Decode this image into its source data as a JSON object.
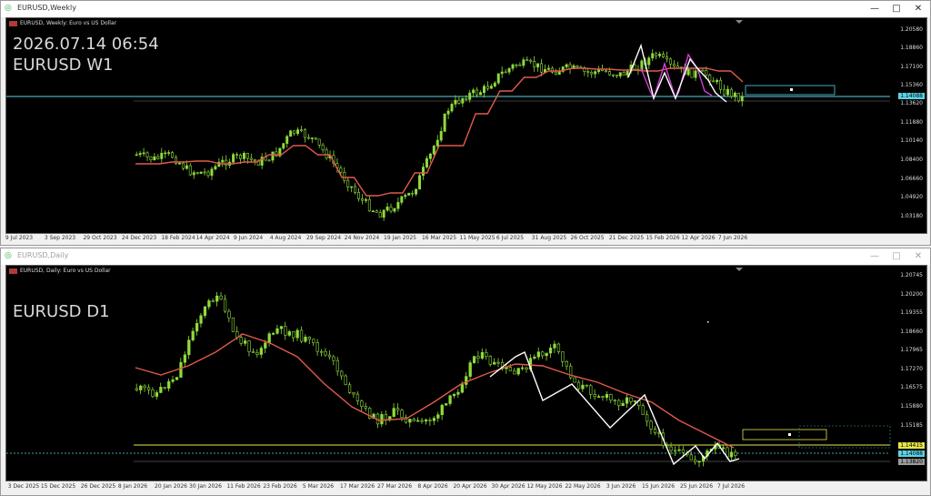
{
  "weekly": {
    "window_title": "EURUSD,Weekly",
    "info": "EURUSD, Weekly:  Euro vs US Dollar",
    "timestamp": "2026.07.14 06:54",
    "label": "EURUSD W1",
    "price_labels": [
      "1.20580",
      "1.18860",
      "1.17100",
      "1.15360",
      "1.13620",
      "1.11880",
      "1.10140",
      "1.08400",
      "1.06660",
      "1.04920",
      "1.03180"
    ],
    "current_price": "1.14088",
    "date_labels": [
      "9 Jul 2023",
      "3 Sep 2023",
      "29 Oct 2023",
      "24 Dec 2023",
      "18 Feb 2024",
      "14 Apr 2024",
      "9 Jun 2024",
      "4 Aug 2024",
      "29 Sep 2024",
      "24 Nov 2024",
      "19 Jan 2025",
      "16 Mar 2025",
      "11 May 2025",
      "6 Jul 2025",
      "31 Aug 2025",
      "26 Oct 2025",
      "21 Dec 2025",
      "15 Feb 2026",
      "12 Apr 2026",
      "7 Jun 2026"
    ]
  },
  "daily": {
    "window_title": "EURUSD,Daily",
    "info": "EURUSD, Daily:  Euro vs US Dollar",
    "label": "EURUSD D1",
    "price_labels": [
      "1.20745",
      "1.20200",
      "1.19355",
      "1.18660",
      "1.17965",
      "1.17270",
      "1.16575",
      "1.15880",
      "1.15185"
    ],
    "yellow_price": "1.14415",
    "current_price": "1.14088",
    "gray_price": "1.13820",
    "date_labels": [
      "3 Dec 2025",
      "15 Dec 2025",
      "26 Dec 2025",
      "8 Jan 2026",
      "20 Jan 2026",
      "30 Jan 2026",
      "11 Feb 2026",
      "23 Feb 2026",
      "5 Mar 2026",
      "17 Mar 2026",
      "27 Mar 2026",
      "8 Apr 2026",
      "20 Apr 2026",
      "30 Apr 2026",
      "12 May 2026",
      "22 May 2026",
      "3 Jun 2026",
      "15 Jun 2026",
      "25 Jun 2026",
      "7 Jul 2026"
    ]
  },
  "colors": {
    "candle": "#8fdc3c",
    "ma": "#e05a4a",
    "zigzag": "#ffffff",
    "pattern": "#d040d0",
    "bid_line": "#5ad4e6",
    "yellow_line": "#e6e64a"
  },
  "icons": {
    "app": "chart-icon",
    "minimize": "minimize-icon",
    "maximize": "maximize-icon",
    "close": "close-icon"
  }
}
